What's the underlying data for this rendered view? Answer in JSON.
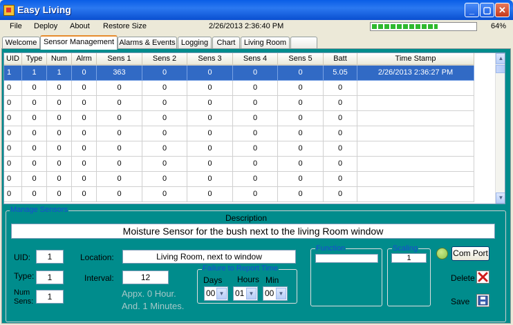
{
  "window": {
    "title": "Easy Living"
  },
  "menu": {
    "items": [
      "File",
      "Deploy",
      "About",
      "Restore Size"
    ]
  },
  "status": {
    "datetime": "2/26/2013 2:36:40 PM",
    "progress_fraction": 0.64,
    "progress_text": "64%"
  },
  "tabs": [
    "Welcome",
    "Sensor Management",
    "Alarms & Events",
    "Logging",
    "Chart",
    "Living Room",
    ""
  ],
  "active_tab": "Sensor Management",
  "grid": {
    "columns": [
      "UID",
      "Type",
      "Num",
      "Alrm",
      "Sens 1",
      "Sens 2",
      "Sens 3",
      "Sens 4",
      "Sens 5",
      "Batt",
      "Time Stamp"
    ],
    "rows": [
      [
        "1",
        "1",
        "1",
        "0",
        "363",
        "0",
        "0",
        "0",
        "0",
        "5.05",
        "2/26/2013 2:36:27 PM"
      ],
      [
        "0",
        "0",
        "0",
        "0",
        "0",
        "0",
        "0",
        "0",
        "0",
        "0",
        ""
      ],
      [
        "0",
        "0",
        "0",
        "0",
        "0",
        "0",
        "0",
        "0",
        "0",
        "0",
        ""
      ],
      [
        "0",
        "0",
        "0",
        "0",
        "0",
        "0",
        "0",
        "0",
        "0",
        "0",
        ""
      ],
      [
        "0",
        "0",
        "0",
        "0",
        "0",
        "0",
        "0",
        "0",
        "0",
        "0",
        ""
      ],
      [
        "0",
        "0",
        "0",
        "0",
        "0",
        "0",
        "0",
        "0",
        "0",
        "0",
        ""
      ],
      [
        "0",
        "0",
        "0",
        "0",
        "0",
        "0",
        "0",
        "0",
        "0",
        "0",
        ""
      ],
      [
        "0",
        "0",
        "0",
        "0",
        "0",
        "0",
        "0",
        "0",
        "0",
        "0",
        ""
      ],
      [
        "0",
        "0",
        "0",
        "0",
        "0",
        "0",
        "0",
        "0",
        "0",
        "0",
        ""
      ]
    ],
    "selected_row": 0
  },
  "manage": {
    "group_label": "Manage Sensors",
    "description_label": "Description",
    "description": "Moisture Sensor for the bush next to the living Room window",
    "uid_label": "UID:",
    "uid": "1",
    "type_label": "Type:",
    "type": "1",
    "numsens_label_1": "Num",
    "numsens_label_2": "Sens:",
    "numsens": "1",
    "location_label": "Location:",
    "location": "Living Room, next to window",
    "interval_label": "Interval:",
    "interval": "12",
    "approx_line1": "Appx. 0 Hour.",
    "approx_line2": "And. 1 Minutes.",
    "failure_label": "Failure to Report Time",
    "days_label": "Days",
    "days": "00",
    "hours_label": "Hours",
    "hours": "01",
    "min_label": "Min",
    "min": "00",
    "function_label": "Function",
    "function_value": "",
    "scaling_label": "Scaling",
    "scaling_value": "1",
    "comport_label": "Com Port",
    "delete_label": "Delete",
    "save_label": "Save"
  },
  "colors": {
    "panel": "#008c8c",
    "selection": "#316ac5",
    "titlebar": "#0a5ee6",
    "progress": "#2fb92f"
  }
}
